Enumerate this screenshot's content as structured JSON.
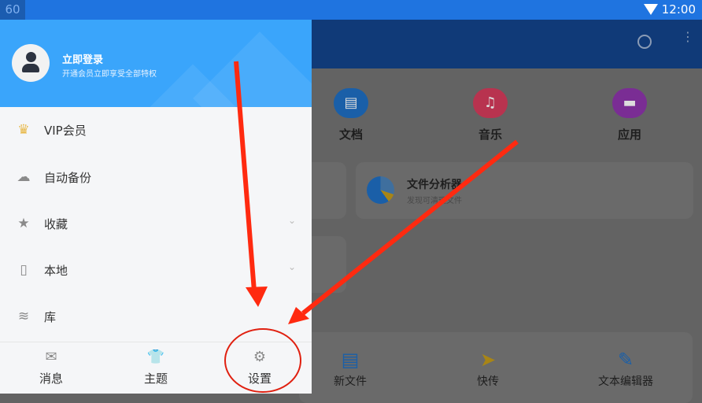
{
  "status_bar": {
    "fps": "60",
    "time": "12:00"
  },
  "drawer": {
    "user": {
      "title": "立即登录",
      "subtitle": "开通会员立即享受全部特权"
    },
    "items": [
      {
        "label": "VIP会员",
        "icon": "crown-icon"
      },
      {
        "label": "自动备份",
        "icon": "cloud-sync-icon"
      },
      {
        "label": "收藏",
        "icon": "star-icon",
        "expandable": true
      },
      {
        "label": "本地",
        "icon": "phone-icon",
        "expandable": true
      },
      {
        "label": "库",
        "icon": "layers-icon"
      }
    ],
    "bottom_nav": [
      {
        "label": "消息",
        "icon": "mail-icon"
      },
      {
        "label": "主题",
        "icon": "tshirt-icon"
      },
      {
        "label": "设置",
        "icon": "gear-icon"
      }
    ]
  },
  "main": {
    "categories": [
      {
        "label": "文档",
        "color": "#1a5fa8"
      },
      {
        "label": "音乐",
        "color": "#b8334f"
      },
      {
        "label": "应用",
        "color": "#7a2d94"
      }
    ],
    "analyzer": {
      "title": "文件分析器",
      "subtitle": "发现可清理文件"
    },
    "tools": [
      {
        "label": "新文件"
      },
      {
        "label": "快传"
      },
      {
        "label": "文本编辑器"
      }
    ]
  },
  "annotation_color": "#ff2a10"
}
